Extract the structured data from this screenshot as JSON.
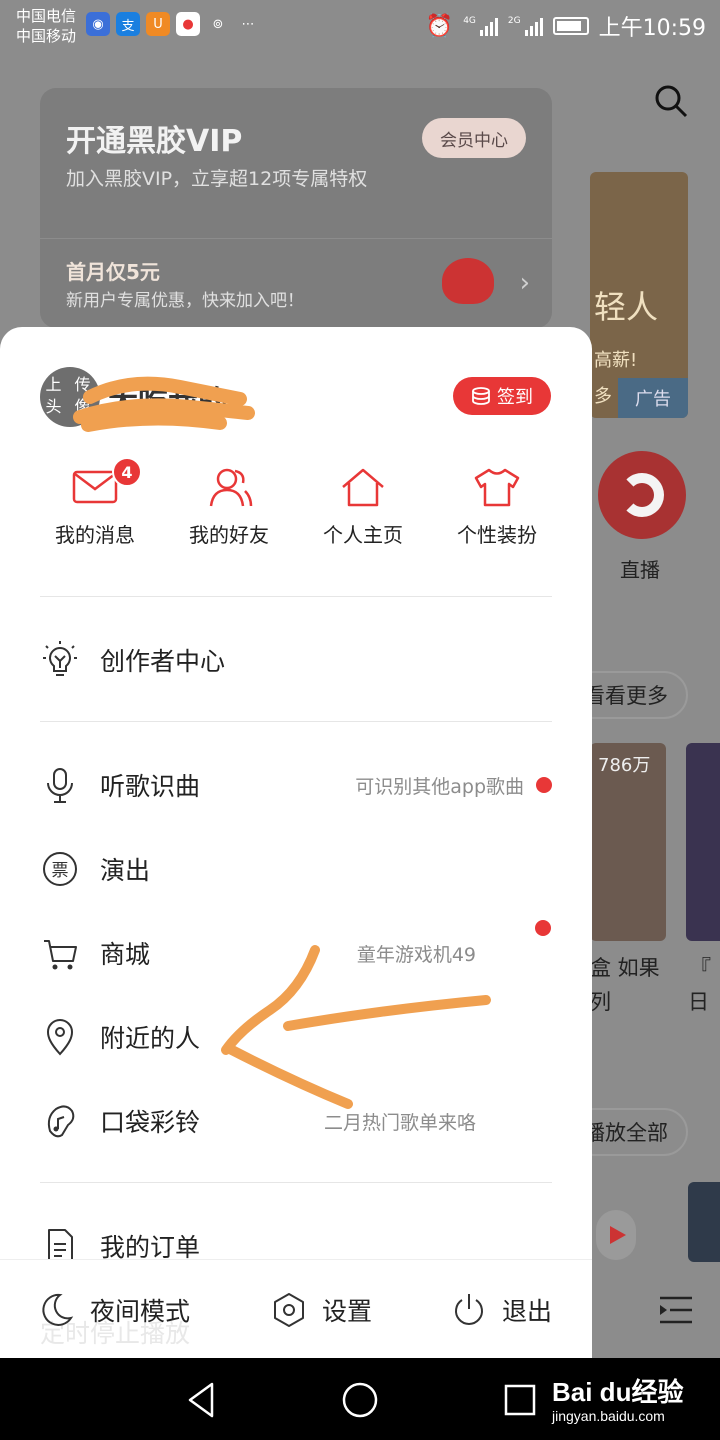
{
  "status_bar": {
    "carrier1": "中国电信",
    "carrier2": "中国移动",
    "network1": "4G",
    "network2": "2G",
    "time": "上午10:59",
    "apps": [
      {
        "glyph": "◉",
        "color": "#3b6fd8"
      },
      {
        "glyph": "支",
        "color": "#1a7fe0"
      },
      {
        "glyph": "U",
        "color": "#f08a24"
      },
      {
        "glyph": "●",
        "color": "#e83737"
      }
    ]
  },
  "background_app": {
    "vip": {
      "title": "开通黑胶VIP",
      "subtitle": "加入黑胶VIP，立享超12项专属特权",
      "center_button": "会员中心",
      "offer_title": "首月仅5元",
      "offer_subtitle": "新用户专属优惠，快来加入吧！"
    },
    "ad": {
      "text": "轻人",
      "sub": "高薪!",
      "more": "多",
      "badge": "广告"
    },
    "live_label": "直播",
    "see_more": "看看更多",
    "thumb_count": "786万",
    "caption1_line1": "盒 如果",
    "caption1_line2": "列",
    "caption2_line1": "『",
    "caption2_line2": "日",
    "play_all": "播放全部"
  },
  "drawer": {
    "avatar_text": "上 传\n头 像",
    "username": "大吃我的",
    "checkin_label": "签到",
    "quick_actions": [
      {
        "icon": "mail-icon",
        "label": "我的消息",
        "badge": "4"
      },
      {
        "icon": "friends-icon",
        "label": "我的好友"
      },
      {
        "icon": "home-icon",
        "label": "个人主页"
      },
      {
        "icon": "tshirt-icon",
        "label": "个性装扮"
      }
    ],
    "creator_center": "创作者中心",
    "menu": [
      {
        "icon": "mic-icon",
        "label": "听歌识曲",
        "hint": "可识别其他app歌曲"
      },
      {
        "icon": "ticket-icon",
        "label": "演出",
        "hint": ""
      },
      {
        "icon": "cart-icon",
        "label": "商城",
        "hint": "童年游戏机49"
      },
      {
        "icon": "location-icon",
        "label": "附近的人",
        "hint": ""
      },
      {
        "icon": "ringtone-icon",
        "label": "口袋彩铃",
        "hint": "二月热门歌单来咯"
      }
    ],
    "orders": "我的订单",
    "hidden_item": "定时停止播放",
    "bottom": {
      "night_mode": "夜间模式",
      "settings": "设置",
      "logout": "退出"
    }
  },
  "annotation_color": "#f0a050",
  "accent_color": "#e83737",
  "watermark": {
    "brand": "Bai du经验",
    "url": "jingyan.baidu.com"
  }
}
